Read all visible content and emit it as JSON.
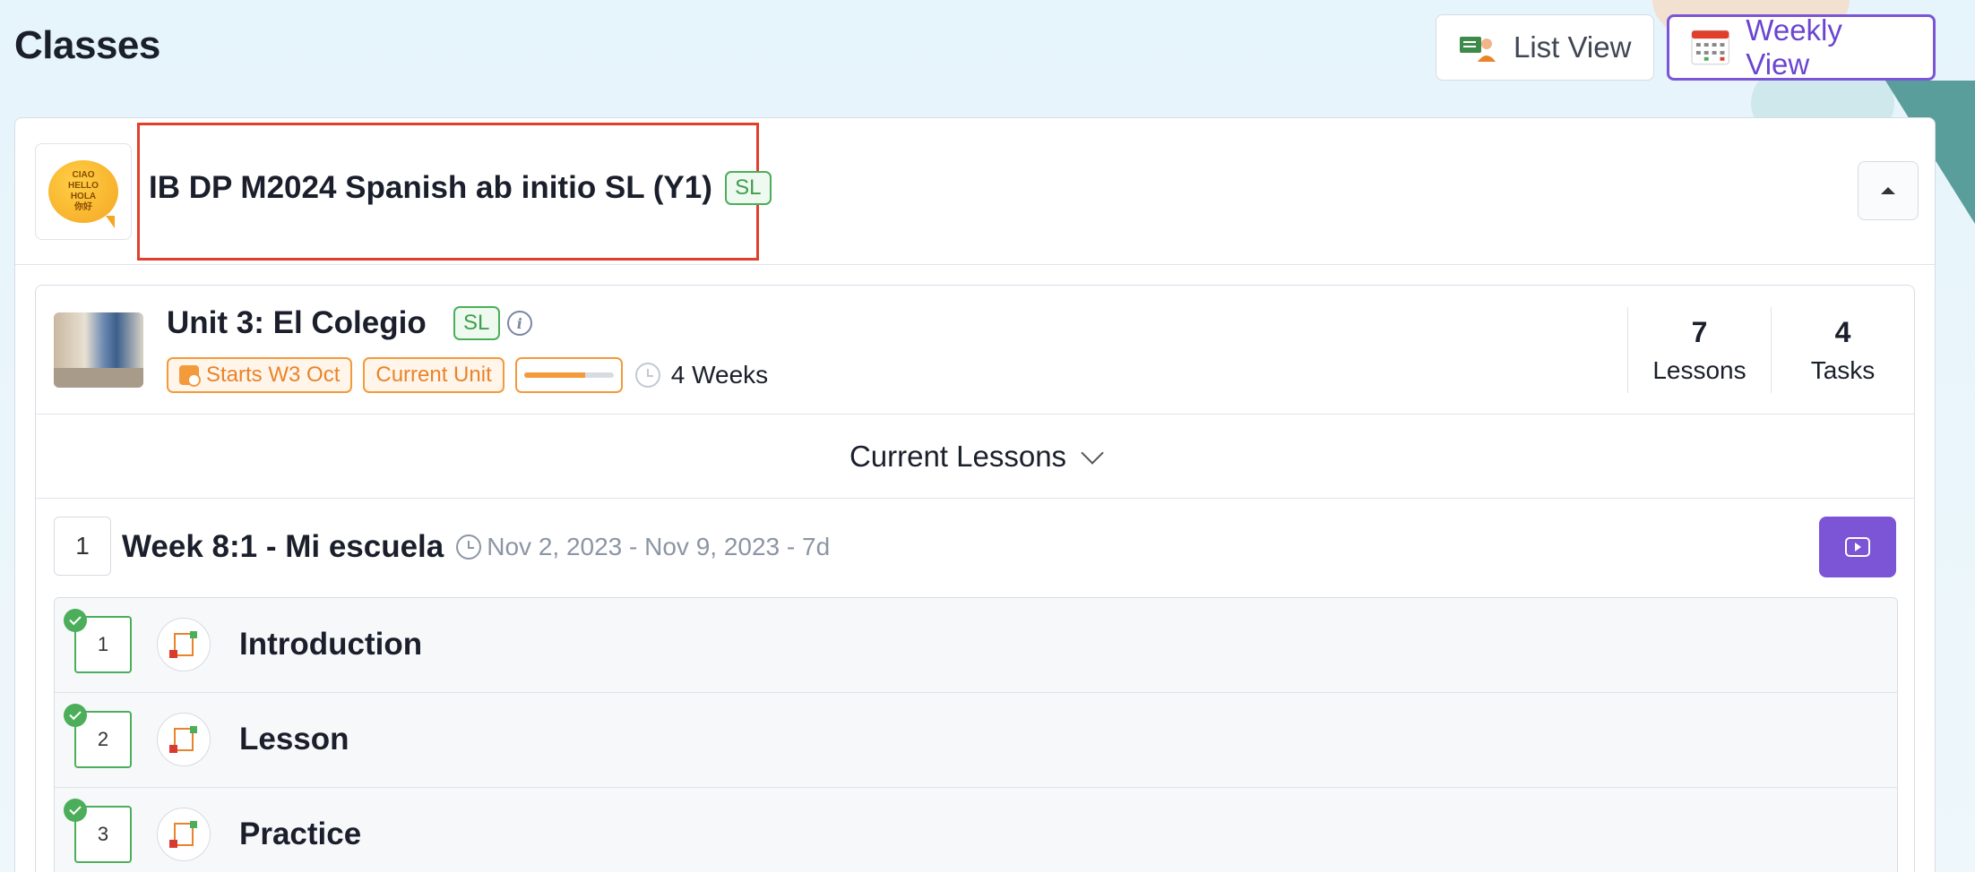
{
  "page": {
    "title": "Classes"
  },
  "views": {
    "list_label": "List View",
    "weekly_label": "Weekly View"
  },
  "class": {
    "title": "IB DP M2024 Spanish ab initio SL (Y1)",
    "level_badge": "SL",
    "logo_lines": [
      "CIAO",
      "HELLO",
      "HOLA",
      "你好"
    ]
  },
  "unit": {
    "title": "Unit 3: El Colegio",
    "level_badge": "SL",
    "info_glyph": "i",
    "starts": "Starts W3 Oct",
    "status": "Current Unit",
    "progress": 0.68,
    "duration": "4 Weeks",
    "stats": [
      {
        "value": "7",
        "label": "Lessons"
      },
      {
        "value": "4",
        "label": "Tasks"
      }
    ]
  },
  "current_lessons_label": "Current Lessons",
  "week": {
    "number": "1",
    "title": "Week 8:1 - Mi escuela",
    "dates": "Nov 2, 2023 - Nov 9, 2023 - 7d"
  },
  "lessons": [
    {
      "number": "1",
      "title": "Introduction",
      "completed": true
    },
    {
      "number": "2",
      "title": "Lesson",
      "completed": true
    },
    {
      "number": "3",
      "title": "Practice",
      "completed": true
    }
  ],
  "colors": {
    "accent_purple": "#7b55d6",
    "success_green": "#4cae5a",
    "warning_orange": "#f39a3b",
    "highlight_red": "#e0402b"
  }
}
